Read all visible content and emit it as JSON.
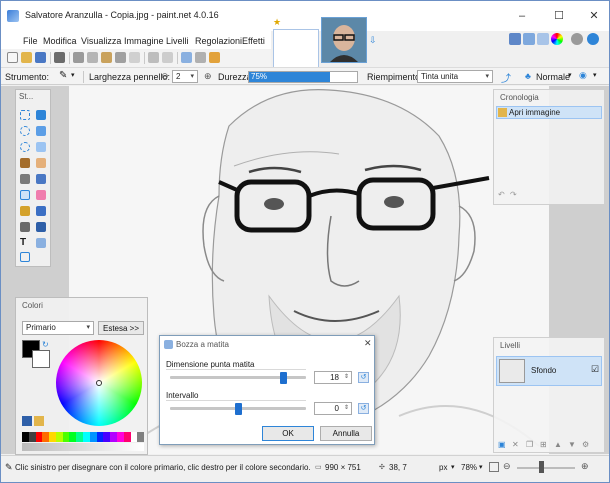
{
  "window": {
    "title": "Salvatore Aranzulla - Copia.jpg - paint.net 4.0.16",
    "minimize": "–",
    "maximize": "☐",
    "close": "✕"
  },
  "menu": [
    "File",
    "Modifica",
    "Visualizza",
    "Immagine",
    "Livelli",
    "Regolazioni",
    "Effetti"
  ],
  "toolbar2": {
    "tool_label": "Strumento:",
    "brush_width_label": "Larghezza pennello:",
    "brush_width_value": "2",
    "hardness_label": "Durezza:",
    "hardness_value": "75%",
    "hardness_fraction": 0.75,
    "fill_label": "Riempimento:",
    "fill_value": "Tinta unita",
    "blend_value": "Normale"
  },
  "tools_panel": {
    "title": "St..."
  },
  "history": {
    "title": "Cronologia",
    "items": [
      "Apri immagine"
    ]
  },
  "layers": {
    "title": "Livelli",
    "items": [
      "Sfondo"
    ]
  },
  "colors": {
    "title": "Colori",
    "mode_value": "Primario",
    "more_button": "Estesa >>"
  },
  "dialog": {
    "title": "Bozza a matita",
    "tip_label": "Dimensione punta matita",
    "tip_value": "18",
    "tip_fraction": 0.85,
    "range_label": "Intervallo",
    "range_value": "0",
    "range_fraction": 0.5,
    "ok": "OK",
    "cancel": "Annulla"
  },
  "status": {
    "hint": "Clic sinistro per disegnare con il colore primario, clic destro per il colore secondario.",
    "size": "990 × 751",
    "coords": "38, 7",
    "unit": "px",
    "zoom": "78%"
  },
  "colors_palette": [
    "#000000",
    "#404040",
    "#ff0000",
    "#ff6a00",
    "#ffd800",
    "#b6ff00",
    "#4cff00",
    "#00ff21",
    "#00ff90",
    "#00ffff",
    "#0094ff",
    "#0026ff",
    "#4800ff",
    "#b200ff",
    "#ff00dc",
    "#ff006e",
    "#ffffff",
    "#808080"
  ]
}
